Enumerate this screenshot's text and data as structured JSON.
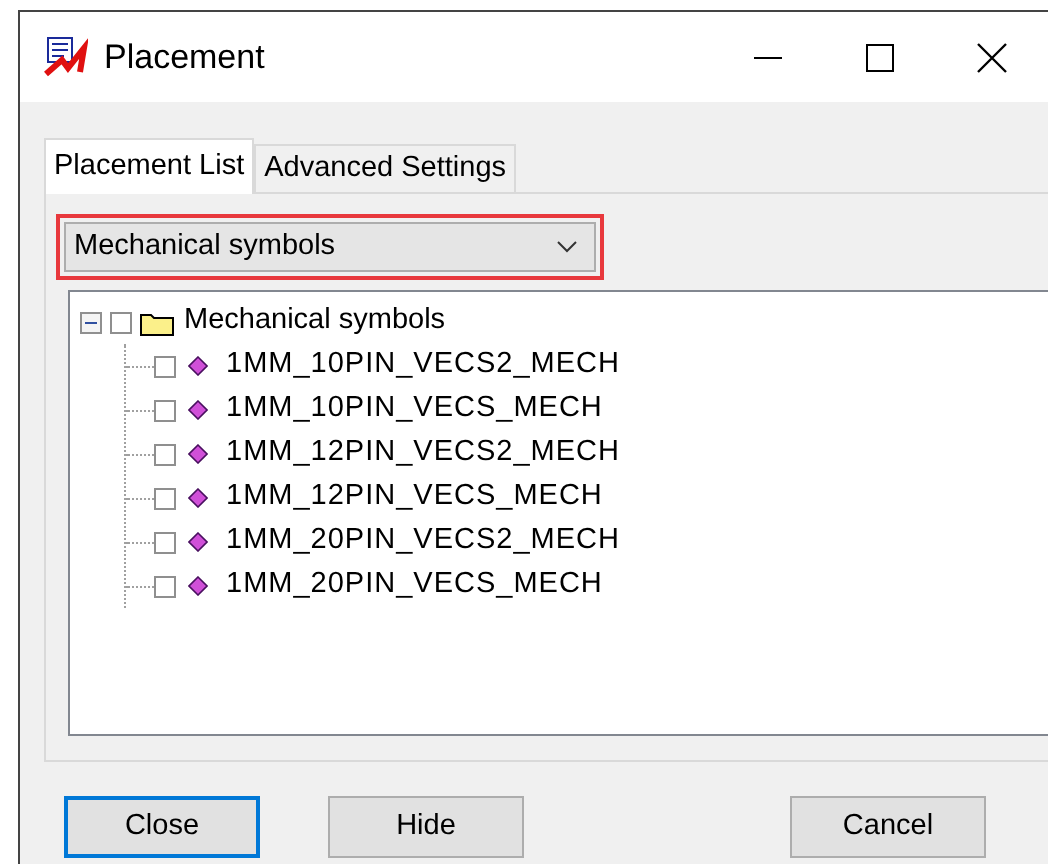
{
  "window": {
    "title": "Placement"
  },
  "tabs": [
    {
      "label": "Placement List",
      "selected": true
    },
    {
      "label": "Advanced Settings",
      "selected": false
    }
  ],
  "dropdown": {
    "value": "Mechanical symbols",
    "highlighted": true
  },
  "tree": [
    {
      "label": "Mechanical symbols",
      "kind": "folder",
      "checked": false,
      "expanded": true,
      "children": [
        {
          "label": "1MM_10PIN_VECS2_MECH",
          "kind": "symbol",
          "checked": false
        },
        {
          "label": "1MM_10PIN_VECS_MECH",
          "kind": "symbol",
          "checked": false
        },
        {
          "label": "1MM_12PIN_VECS2_MECH",
          "kind": "symbol",
          "checked": false
        },
        {
          "label": "1MM_12PIN_VECS_MECH",
          "kind": "symbol",
          "checked": false
        },
        {
          "label": "1MM_20PIN_VECS2_MECH",
          "kind": "symbol",
          "checked": false
        },
        {
          "label": "1MM_20PIN_VECS_MECH",
          "kind": "symbol",
          "checked": false
        }
      ]
    }
  ],
  "buttons": [
    {
      "label": "Close",
      "default": true
    },
    {
      "label": "Hide",
      "default": false
    },
    {
      "label": "Cancel",
      "default": false
    }
  ]
}
